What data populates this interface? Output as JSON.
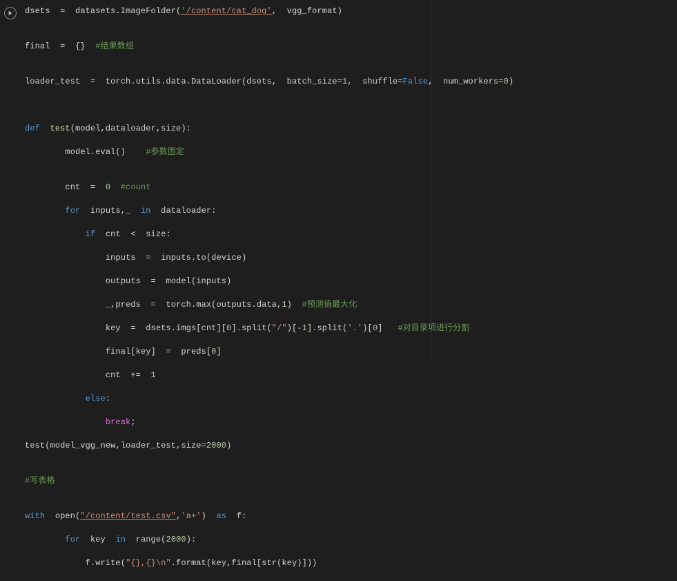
{
  "code": {
    "l1a": "dsets  =  datasets.ImageFolder(",
    "l1path": "'/content/cat_dog'",
    "l1b": ",  vgg_format)",
    "l2a": "final  =  {}  ",
    "l2cmt": "#结果数组",
    "l3a": "loader_test  =  torch.utils.data.DataLoader(dsets,  batch_size=",
    "l3num1": "1",
    "l3b": ",  shuffle=",
    "l3false": "False",
    "l3c": ",  num_workers=",
    "l3num0": "0",
    "l3d": ")",
    "l4def": "def",
    "l4a": "  ",
    "l4fn": "test",
    "l4b": "(model,dataloader,size):",
    "l5a": "        model.eval()    ",
    "l5cmt": "#参数固定",
    "l6a": "        cnt  =  ",
    "l6num": "0",
    "l6b": "  ",
    "l6cmt": "#count",
    "l7for": "for",
    "l7a": "  inputs,_  ",
    "l7in": "in",
    "l7b": "  dataloader:",
    "l8if": "if",
    "l8a": "  cnt  <  size:",
    "l9a": "                inputs  =  inputs.to(device)",
    "l10a": "                outputs  =  model(inputs)",
    "l11a": "                _,preds  =  torch.max(outputs.data,",
    "l11num": "1",
    "l11b": ")  ",
    "l11cmt": "#预测值最大化",
    "l12a": "                key  =  dsets.imgs[cnt][",
    "l12num0": "0",
    "l12b": "].split(",
    "l12str1": "\"/\"",
    "l12c": ")[",
    "l12neg1": "-1",
    "l12d": "].split(",
    "l12str2": "'.'",
    "l12e": ")[",
    "l12num0b": "0",
    "l12f": "]   ",
    "l12cmt": "#对目录项进行分割",
    "l13a": "                final[key]  =  preds[",
    "l13num": "0",
    "l13b": "]",
    "l14a": "                cnt  +=  ",
    "l14num": "1",
    "l15else": "else",
    "l15a": ":",
    "l16break": "break",
    "l16a": ";",
    "l17a": "test(model_vgg_new,loader_test,size=",
    "l17num": "2000",
    "l17b": ")",
    "l18cmt": "#写表格",
    "l19with": "with",
    "l19a": "  open(",
    "l19str1": "\"/content/test.csv\"",
    "l19b": ",",
    "l19str2": "'a+'",
    "l19c": ")  ",
    "l19as": "as",
    "l19d": "  f:",
    "l20for": "for",
    "l20a": "  key  ",
    "l20in": "in",
    "l20b": "  range(",
    "l20num": "2000",
    "l20c": "):",
    "l21a": "            f.write(",
    "l21str": "\"{},{}\\n\"",
    "l21b": ".format(key,final[str(key)]))"
  }
}
